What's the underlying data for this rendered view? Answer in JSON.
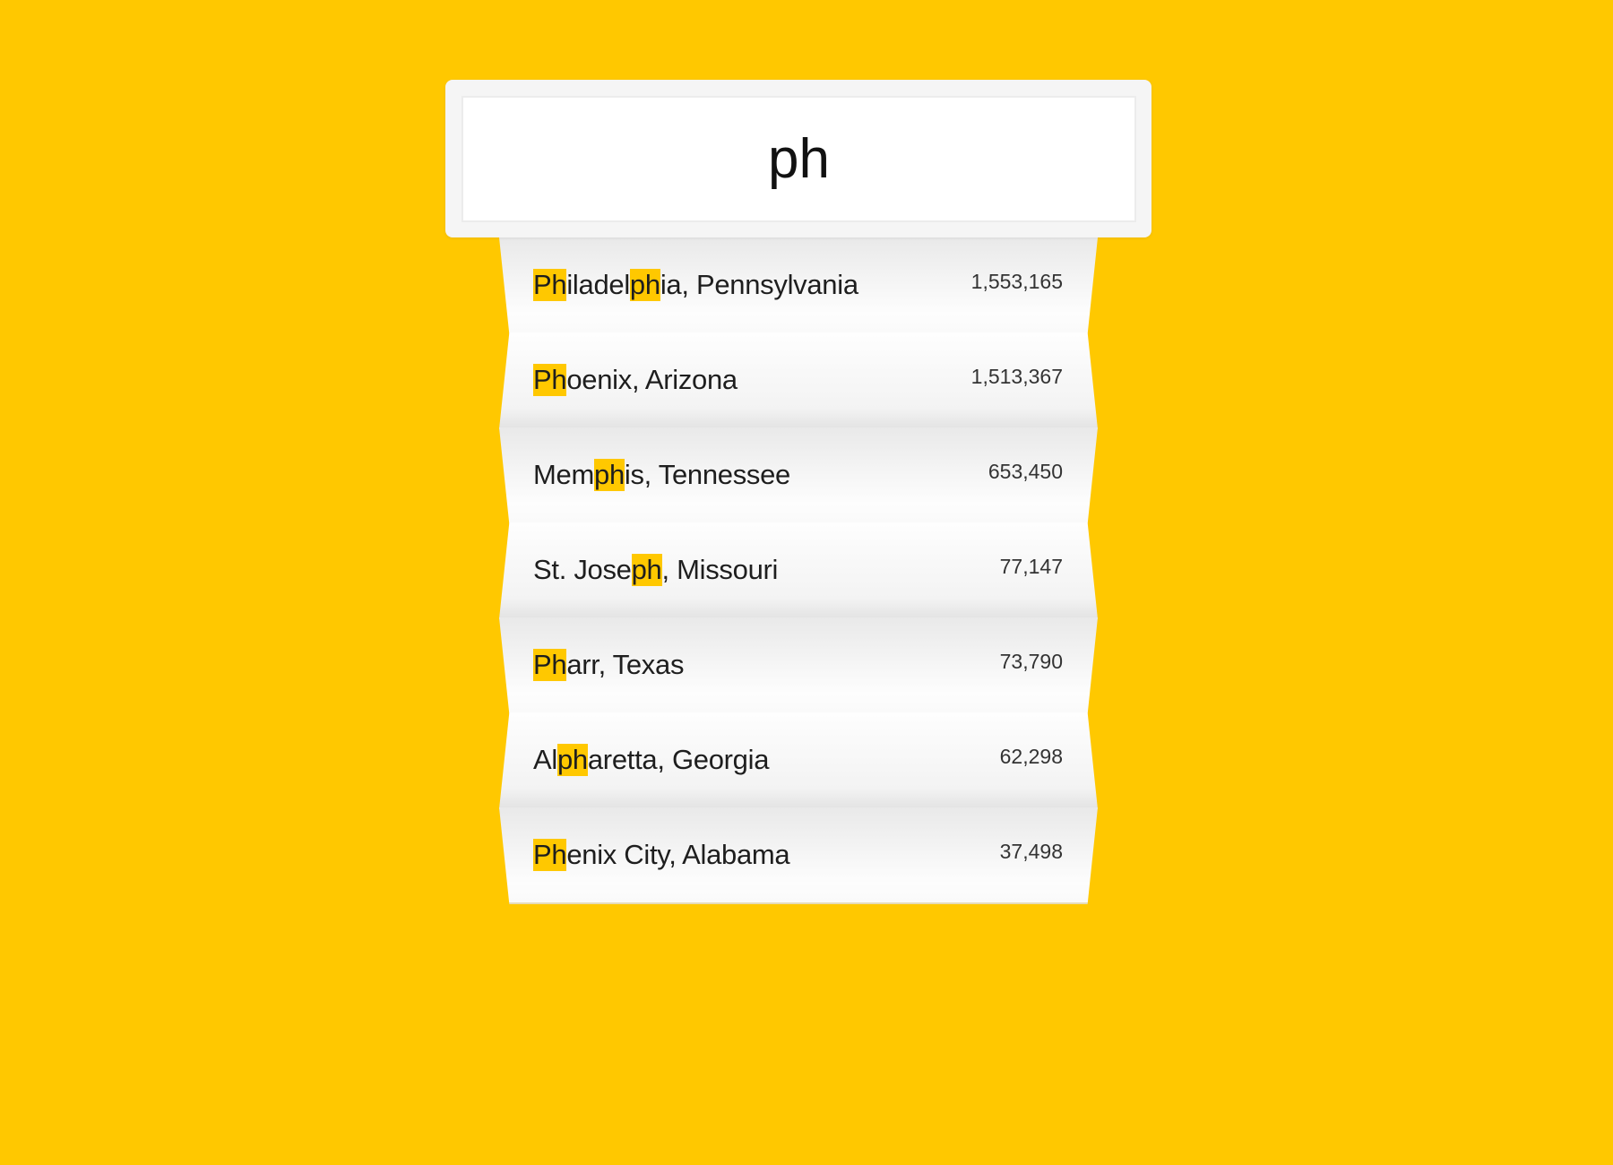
{
  "search": {
    "value": "ph"
  },
  "colors": {
    "background": "#ffc800",
    "highlight": "#ffc800"
  },
  "results": [
    {
      "segments": [
        {
          "t": "Ph",
          "hl": true
        },
        {
          "t": "iladel",
          "hl": false
        },
        {
          "t": "ph",
          "hl": true
        },
        {
          "t": "ia, Pennsylvania",
          "hl": false
        }
      ],
      "population": "1,553,165"
    },
    {
      "segments": [
        {
          "t": "Ph",
          "hl": true
        },
        {
          "t": "oenix, Arizona",
          "hl": false
        }
      ],
      "population": "1,513,367"
    },
    {
      "segments": [
        {
          "t": "Mem",
          "hl": false
        },
        {
          "t": "ph",
          "hl": true
        },
        {
          "t": "is, Tennessee",
          "hl": false
        }
      ],
      "population": "653,450"
    },
    {
      "segments": [
        {
          "t": "St. Jose",
          "hl": false
        },
        {
          "t": "ph",
          "hl": true
        },
        {
          "t": ", Missouri",
          "hl": false
        }
      ],
      "population": "77,147"
    },
    {
      "segments": [
        {
          "t": "Ph",
          "hl": true
        },
        {
          "t": "arr, Texas",
          "hl": false
        }
      ],
      "population": "73,790"
    },
    {
      "segments": [
        {
          "t": "Al",
          "hl": false
        },
        {
          "t": "ph",
          "hl": true
        },
        {
          "t": "aretta, Georgia",
          "hl": false
        }
      ],
      "population": "62,298"
    },
    {
      "segments": [
        {
          "t": "Ph",
          "hl": true
        },
        {
          "t": "enix City, Alabama",
          "hl": false
        }
      ],
      "population": "37,498"
    }
  ]
}
